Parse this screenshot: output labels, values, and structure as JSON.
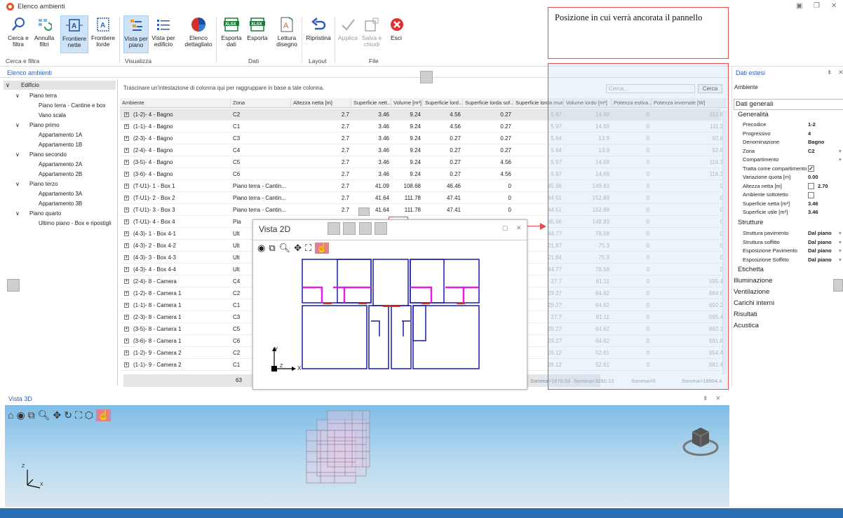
{
  "window": {
    "title": "Elenco ambienti"
  },
  "ribbon": {
    "buttons": [
      {
        "id": "cerca-filtra",
        "label1": "Cerca e",
        "label2": "filtra"
      },
      {
        "id": "annulla-filtri",
        "label1": "Annulla",
        "label2": "filtri"
      },
      {
        "id": "frontiere-nette",
        "label1": "Frontiere",
        "label2": "nette"
      },
      {
        "id": "frontiere-lorde",
        "label1": "Frontiere",
        "label2": "lorde"
      },
      {
        "id": "vista-piano",
        "label1": "Vista per",
        "label2": "piano"
      },
      {
        "id": "vista-edificio",
        "label1": "Vista per",
        "label2": "edificio"
      },
      {
        "id": "elenco-dettagliato",
        "label1": "Elenco",
        "label2": "dettagliato"
      },
      {
        "id": "esporta-dati",
        "label1": "Esporta",
        "label2": "dati"
      },
      {
        "id": "esporta",
        "label1": "Esporta",
        "label2": ""
      },
      {
        "id": "lettura-disegno",
        "label1": "Lettura",
        "label2": "disegno"
      },
      {
        "id": "ripristina",
        "label1": "Ripristina",
        "label2": ""
      },
      {
        "id": "applica",
        "label1": "Applica",
        "label2": ""
      },
      {
        "id": "salva-chiudi",
        "label1": "Salva e",
        "label2": "chiudi"
      },
      {
        "id": "esci",
        "label1": "Esci",
        "label2": ""
      }
    ],
    "groups": [
      "Cerca e filtra",
      "Visualizza",
      "Dati",
      "Layout",
      "File"
    ]
  },
  "note": {
    "text": "Posizione in cui verrà ancorata il pannello"
  },
  "tree": {
    "title": "Elenco ambienti",
    "root": "Edificio",
    "items": [
      {
        "label": "Piano terra",
        "level": 1
      },
      {
        "label": "Piano terra - Cantine e box",
        "level": 2
      },
      {
        "label": "Vano scala",
        "level": 2
      },
      {
        "label": "Piano primo",
        "level": 1
      },
      {
        "label": "Appartamento 1A",
        "level": 2
      },
      {
        "label": "Appartamento 1B",
        "level": 2
      },
      {
        "label": "Piano secondo",
        "level": 1
      },
      {
        "label": "Appartamento 2A",
        "level": 2
      },
      {
        "label": "Appartamento 2B",
        "level": 2
      },
      {
        "label": "Piano terzo",
        "level": 1
      },
      {
        "label": "Appartamento 3A",
        "level": 2
      },
      {
        "label": "Appartamento 3B",
        "level": 2
      },
      {
        "label": "Piano quarto",
        "level": 1
      },
      {
        "label": "Ultimo piano - Box e ripostigli",
        "level": 2
      }
    ]
  },
  "grid": {
    "group_hint": "Trascinare un'intestazione di colonna qui per raggruppare in base a tale colonna.",
    "search_placeholder": "Cerca...",
    "search_button": "Cerca",
    "columns": [
      "Ambiente",
      "Zona",
      "Altezza netta [m]",
      "Superficie nett...",
      "Volume [m³]",
      "Superficie lord...",
      "Superficie lorda sof...",
      "Superficie lorda muri...",
      "Volume lordo [m³]",
      "Potenza estiva...",
      "Potenza invernale [W]"
    ],
    "rows": [
      [
        "(1-2)- 4 - Bagno",
        "C2",
        "2.7",
        "3.46",
        "9.24",
        "4.56",
        "0.27",
        "5.97",
        "14.69",
        "0",
        "110.8"
      ],
      [
        "(1-1)- 4 - Bagno",
        "C1",
        "2.7",
        "3.46",
        "9.24",
        "4.56",
        "0.27",
        "5.97",
        "14.69",
        "0",
        "111.2"
      ],
      [
        "(2-3)- 4 - Bagno",
        "C3",
        "2.7",
        "3.46",
        "9.24",
        "0.27",
        "0.27",
        "5.64",
        "13.9",
        "0",
        "92.8"
      ],
      [
        "(2-4)- 4 - Bagno",
        "C4",
        "2.7",
        "3.46",
        "9.24",
        "0.27",
        "0.27",
        "5.64",
        "13.9",
        "0",
        "92.8"
      ],
      [
        "(3-5)- 4 - Bagno",
        "C5",
        "2.7",
        "3.46",
        "9.24",
        "0.27",
        "4.56",
        "5.97",
        "14.69",
        "0",
        "116.3"
      ],
      [
        "(3-6)- 4 - Bagno",
        "C6",
        "2.7",
        "3.46",
        "9.24",
        "0.27",
        "4.56",
        "5.97",
        "14.69",
        "0",
        "116.3"
      ],
      [
        "(T-U1)- 1 - Box 1",
        "Piano terra - Cantin...",
        "2.7",
        "41.09",
        "108.68",
        "46.46",
        "0",
        "45.96",
        "149.83",
        "0",
        "0"
      ],
      [
        "(T-U1)- 2 - Box 2",
        "Piano terra - Cantin...",
        "2.7",
        "41.64",
        "111.78",
        "47.41",
        "0",
        "44.51",
        "152.89",
        "0",
        "0"
      ],
      [
        "(T-U1)- 3 - Box 3",
        "Piano terra - Cantin...",
        "2.7",
        "41.64",
        "111.78",
        "47.41",
        "0",
        "44.51",
        "152.89",
        "0",
        "0"
      ],
      [
        "(T-U1)- 4 - Box 4",
        "Pia",
        "",
        "",
        "",
        "",
        "",
        "45.96",
        "149.83",
        "0",
        "0"
      ],
      [
        "(4-3)- 1 - Box 4-1",
        "Ult",
        "",
        "",
        "",
        "",
        "",
        "44.77",
        "78.58",
        "0",
        "0"
      ],
      [
        "(4-3)- 2 - Box 4-2",
        "Ult",
        "",
        "",
        "",
        "",
        "",
        "21.87",
        "75.3",
        "0",
        "0"
      ],
      [
        "(4-3)- 3 - Box 4-3",
        "Ult",
        "",
        "",
        "",
        "",
        "",
        "21.84",
        "75.3",
        "0",
        "0"
      ],
      [
        "(4-3)- 4 - Box 4-4",
        "Ult",
        "",
        "",
        "",
        "",
        "",
        "44.77",
        "78.58",
        "0",
        "0"
      ],
      [
        "(2-4)- 8 - Camera",
        "C4",
        "",
        "",
        "",
        "",
        "",
        "27.7",
        "61.11",
        "0",
        "595.4"
      ],
      [
        "(1-2)- 8 - Camera 1",
        "C2",
        "",
        "",
        "",
        "",
        "",
        "29.27",
        "64.62",
        "0",
        "684.6"
      ],
      [
        "(1-1)- 8 - Camera 1",
        "C1",
        "",
        "",
        "",
        "",
        "",
        "29.27",
        "64.62",
        "0",
        "692.2"
      ],
      [
        "(2-3)- 8 - Camera 1",
        "C3",
        "",
        "",
        "",
        "",
        "",
        "27.7",
        "61.11",
        "0",
        "595.4"
      ],
      [
        "(3-5)- 8 - Camera 1",
        "C5",
        "",
        "",
        "",
        "",
        "",
        "29.27",
        "64.62",
        "0",
        "692.1"
      ],
      [
        "(3-6)- 8 - Camera 1",
        "C6",
        "",
        "",
        "",
        "",
        "",
        "29.27",
        "64.62",
        "0",
        "691.8"
      ],
      [
        "(1-2)- 9 - Camera 2",
        "C2",
        "",
        "",
        "",
        "",
        "",
        "26.12",
        "52.61",
        "0",
        "654.4"
      ],
      [
        "(1-1)- 9 - Camera 2",
        "C1",
        "",
        "",
        "",
        "",
        "",
        "26.12",
        "52.61",
        "0",
        "681.4"
      ]
    ],
    "footer_count": "63",
    "sums": [
      "Somma=1678.53",
      "Somma=3090.13",
      "Somma=0",
      "Somma=18964.4"
    ]
  },
  "right_panel": {
    "title": "Dati estesi",
    "subtitle": "Ambiente",
    "sections": {
      "dati_generali": "Dati generali",
      "generalita": "Generalità",
      "strutture": "Strutture",
      "etichetta": "Etichetta",
      "illuminazione": "Illuminazione",
      "ventilazione": "Ventilazione",
      "carichi": "Carichi interni",
      "risultati": "Risultati",
      "acustica": "Acustica"
    },
    "props": [
      {
        "k": "Precodice",
        "v": "1-2"
      },
      {
        "k": "Progressivo",
        "v": "4"
      },
      {
        "k": "Denominazione",
        "v": "Bagno"
      },
      {
        "k": "Zona",
        "v": "C2"
      },
      {
        "k": "Compartimento",
        "v": ""
      },
      {
        "k": "Tratta come compartimento",
        "v": "✓"
      },
      {
        "k": "Variazione quota [m]",
        "v": "0.00"
      },
      {
        "k": "Altezza netta [m]",
        "v": "2.70"
      },
      {
        "k": "Ambiente sottotetto",
        "v": ""
      },
      {
        "k": "Superficie netta [m²]",
        "v": "3.46"
      },
      {
        "k": "Superficie utile [m²]",
        "v": "3.46"
      }
    ],
    "strutture": [
      {
        "k": "Struttura pavimento",
        "v": "Dal piano"
      },
      {
        "k": "Struttura soffitto",
        "v": "Dal piano"
      },
      {
        "k": "Esposizione Pavimento",
        "v": "Dal piano"
      },
      {
        "k": "Esposizione Soffitto",
        "v": "Dal piano"
      }
    ]
  },
  "vista2d": {
    "title": "Vista 2D",
    "axis_y": "Y",
    "axis_x": "X",
    "axis_z": "Z"
  },
  "vista3d": {
    "title": "Vista 3D",
    "axis_z": "Z",
    "axis_x": "X",
    "axis_y": "Y"
  },
  "colors": {
    "accent": "#2f5fb3",
    "plan_lines": "#1a1aa8",
    "plan_magenta": "#e020e0",
    "note_border": "#e05050",
    "status": "#2a6fb5"
  }
}
